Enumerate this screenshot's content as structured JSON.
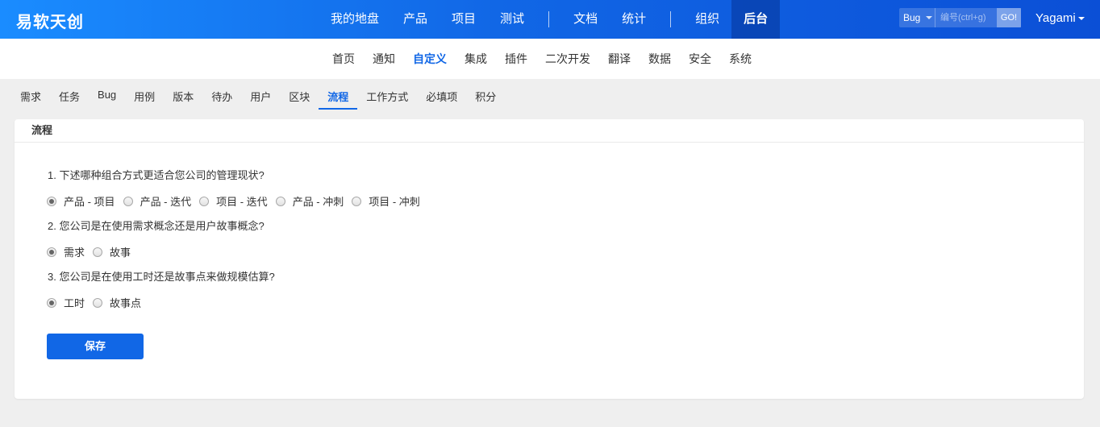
{
  "brand": "易软天创",
  "main_nav": [
    "我的地盘",
    "产品",
    "项目",
    "测试",
    "文档",
    "统计",
    "组织",
    "后台"
  ],
  "main_nav_active": "后台",
  "search": {
    "type": "Bug",
    "placeholder": "编号(ctrl+g)",
    "go_label": "GO!"
  },
  "user": "Yagami",
  "sub_nav": [
    "首页",
    "通知",
    "自定义",
    "集成",
    "插件",
    "二次开发",
    "翻译",
    "数据",
    "安全",
    "系统"
  ],
  "sub_nav_active": "自定义",
  "tabs": [
    "需求",
    "任务",
    "Bug",
    "用例",
    "版本",
    "待办",
    "用户",
    "区块",
    "流程",
    "工作方式",
    "必填项",
    "积分"
  ],
  "tabs_active": "流程",
  "panel": {
    "title": "流程",
    "questions": [
      {
        "text": "1. 下述哪种组合方式更适合您公司的管理现状?",
        "options": [
          "产品 - 项目",
          "产品 - 迭代",
          "项目 - 迭代",
          "产品 - 冲刺",
          "项目 - 冲刺"
        ],
        "selected": 0
      },
      {
        "text": "2. 您公司是在使用需求概念还是用户故事概念?",
        "options": [
          "需求",
          "故事"
        ],
        "selected": 0
      },
      {
        "text": "3. 您公司是在使用工时还是故事点来做规模估算?",
        "options": [
          "工时",
          "故事点"
        ],
        "selected": 0
      }
    ],
    "save_label": "保存"
  },
  "colors": {
    "accent": "#1167e6",
    "header_start": "#1a8cff",
    "header_end": "#0b4fd6",
    "background": "#efefef"
  }
}
